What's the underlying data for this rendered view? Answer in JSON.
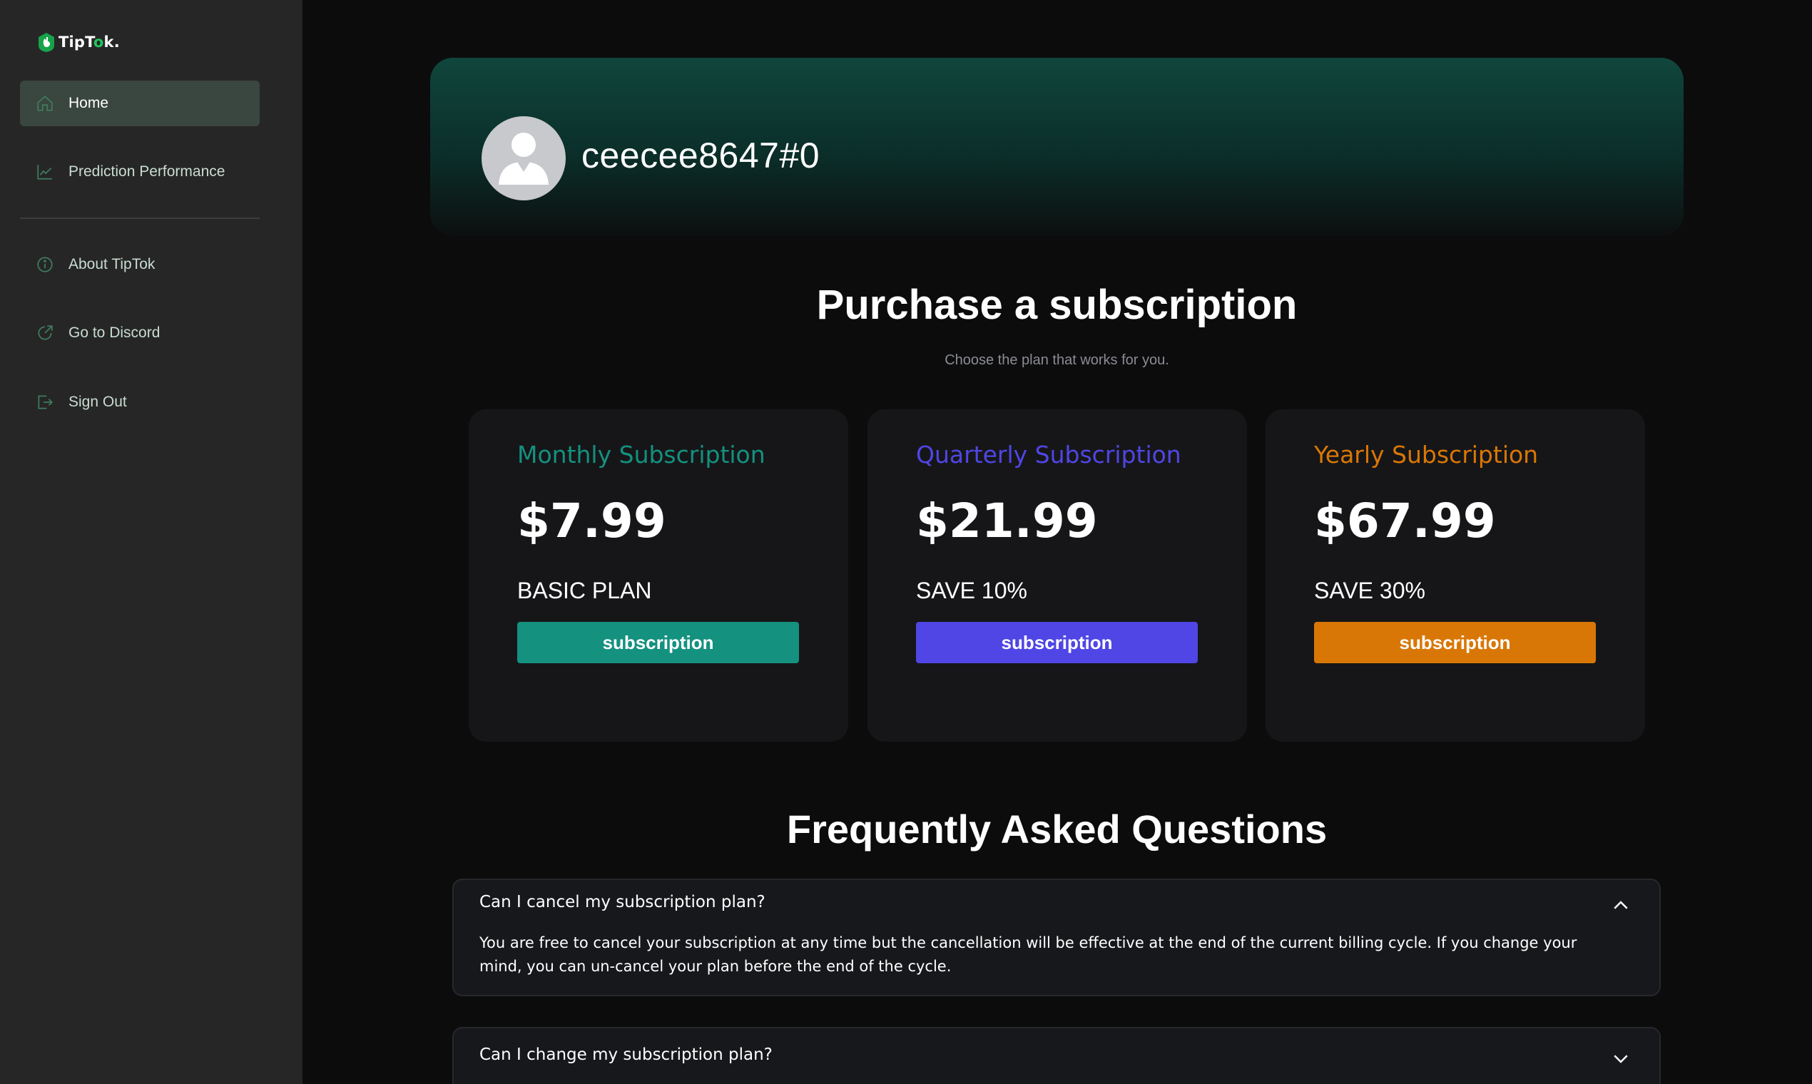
{
  "sidebar": {
    "logo": {
      "text_before": "TipT",
      "text_dot": "o",
      "text_after": "k."
    },
    "items": [
      {
        "label": "Home",
        "icon": "home-icon",
        "active": true
      },
      {
        "label": "Prediction Performance",
        "icon": "chart-line-icon",
        "active": false
      },
      {
        "label": "About TipTok",
        "icon": "info-icon",
        "active": false
      },
      {
        "label": "Go to Discord",
        "icon": "external-link-icon",
        "active": false
      },
      {
        "label": "Sign Out",
        "icon": "sign-out-icon",
        "active": false
      }
    ]
  },
  "profile": {
    "username": "ceecee8647#0",
    "avatar_icon": "user-avatar-icon"
  },
  "purchase": {
    "title": "Purchase a subscription",
    "subtitle": "Choose the plan that works for you.",
    "plans": [
      {
        "title": "Monthly Subscription",
        "price": "$7.99",
        "tag": "BASIC PLAN",
        "button": "subscription",
        "accent": "#14917f",
        "title_color": "#14917f"
      },
      {
        "title": "Quarterly Subscription",
        "price": "$21.99",
        "tag": "SAVE 10%",
        "button": "subscription",
        "accent": "#4f46e5",
        "title_color": "#4f46e5"
      },
      {
        "title": "Yearly Subscription",
        "price": "$67.99",
        "tag": "SAVE 30%",
        "button": "subscription",
        "accent": "#d97706",
        "title_color": "#d97706"
      }
    ]
  },
  "faq": {
    "title": "Frequently Asked Questions",
    "items": [
      {
        "question": "Can I cancel my subscription plan?",
        "answer": "You are free to cancel your subscription at any time but the cancellation will be effective at the end of the current billing cycle. If you change your mind, you can un-cancel your plan before the end of the cycle.",
        "expanded": true
      },
      {
        "question": "Can I change my subscription plan?",
        "answer": "",
        "expanded": false
      }
    ]
  }
}
